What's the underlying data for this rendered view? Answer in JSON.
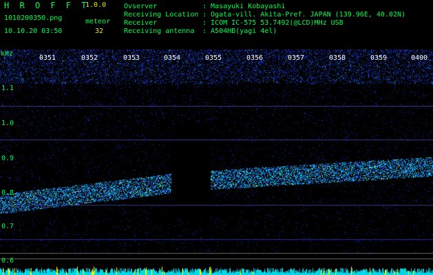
{
  "header": {
    "app_title": "H R O F F T",
    "version": "1.0.0",
    "filename": "1010200350.png",
    "meteor_label": "meteor",
    "datetime": "10.10.20 03:50",
    "meteor_count": "32",
    "info": [
      {
        "key": "Ovserver",
        "value": ": Masayuki Kobayashi"
      },
      {
        "key": "Receiving Location",
        "value": ": Ogata-vill. Akita-Pref. JAPAN (139.96E, 40.02N)"
      },
      {
        "key": "Receiver",
        "value": ": ICOM IC-575 53.7492(@LCD)MHz USB"
      },
      {
        "key": "Receiving antenna",
        "value": ": A504HB(yagi 4el)"
      }
    ]
  },
  "spectrogram": {
    "freq_unit": "kHz",
    "freq_labels": [
      "1.1",
      "1.0",
      "0.9",
      "0.8",
      "0.7",
      "0.6"
    ],
    "time_labels": [
      "0351",
      "0352",
      "0353",
      "0354",
      "0355",
      "0356",
      "0357",
      "0358",
      "0359",
      "0400"
    ],
    "colors": {
      "background": "#000000",
      "noise": "#1a2fd0",
      "signal": "#00e0ff",
      "peak": "#ffff00",
      "text": "#00ff4c"
    }
  }
}
